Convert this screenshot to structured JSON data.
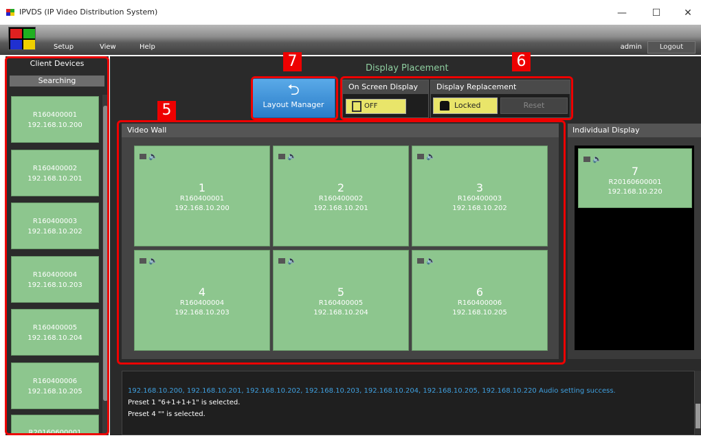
{
  "window": {
    "title": "IPVDS (IP Video Distribution System)",
    "minimize": "—",
    "maximize": "☐",
    "close": "✕"
  },
  "menu": {
    "setup": "Setup",
    "view": "View",
    "help": "Help",
    "user": "admin",
    "logout": "Logout"
  },
  "client_devices": {
    "title": "Client Devices",
    "status": "Searching",
    "items": [
      {
        "id": "R160400001",
        "ip": "192.168.10.200"
      },
      {
        "id": "R160400002",
        "ip": "192.168.10.201"
      },
      {
        "id": "R160400003",
        "ip": "192.168.10.202"
      },
      {
        "id": "R160400004",
        "ip": "192.168.10.203"
      },
      {
        "id": "R160400005",
        "ip": "192.168.10.204"
      },
      {
        "id": "R160400006",
        "ip": "192.168.10.205"
      },
      {
        "id": "R20160600001",
        "ip": ""
      }
    ]
  },
  "display_placement": {
    "title": "Display Placement",
    "layout_manager": "Layout Manager",
    "osd_title": "On Screen Display",
    "osd_value": "OFF",
    "replacement_title": "Display Replacement",
    "lock_label": "Locked",
    "reset_label": "Reset"
  },
  "video_wall": {
    "title": "Video Wall",
    "tiles": [
      {
        "num": "1",
        "id": "R160400001",
        "ip": "192.168.10.200"
      },
      {
        "num": "2",
        "id": "R160400002",
        "ip": "192.168.10.201"
      },
      {
        "num": "3",
        "id": "R160400003",
        "ip": "192.168.10.202"
      },
      {
        "num": "4",
        "id": "R160400004",
        "ip": "192.168.10.203"
      },
      {
        "num": "5",
        "id": "R160400005",
        "ip": "192.168.10.204"
      },
      {
        "num": "6",
        "id": "R160400006",
        "ip": "192.168.10.205"
      }
    ]
  },
  "individual_display": {
    "title": "Individual Display",
    "tile": {
      "num": "7",
      "id": "R20160600001",
      "ip": "192.168.10.220"
    }
  },
  "log": [
    "192.168.10.200, 192.168.10.201, 192.168.10.202, 192.168.10.203, 192.168.10.204, 192.168.10.205, 192.168.10.220 Audio setting success.",
    "Preset 1 \"6+1+1+1\" is selected.",
    "Preset 4 \"\" is selected."
  ],
  "annotations": {
    "b5": "5",
    "b6": "6",
    "b7": "7"
  },
  "colors": {
    "tile": "#8dc68e",
    "highlight": "#ee0000",
    "button_blue": "#2a7cc8",
    "yellow": "#e9e56a"
  }
}
